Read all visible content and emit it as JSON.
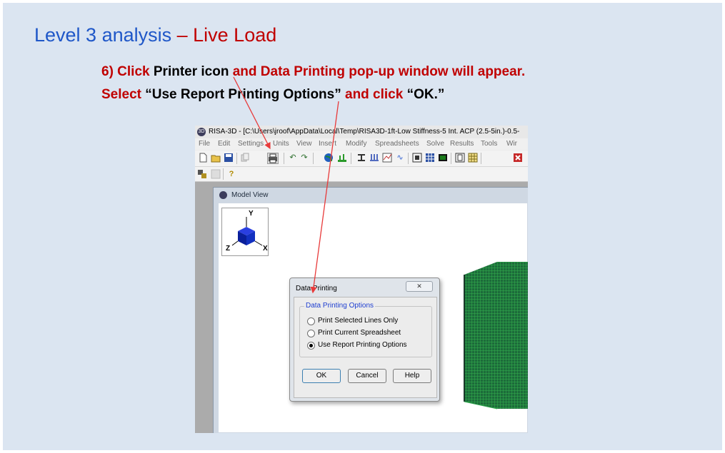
{
  "slide": {
    "title_part1": "Level 3 analysis",
    "title_part2": " – Live Load",
    "line1": {
      "a": "6) Click ",
      "b": "Printer icon",
      "c": " and Data Printing pop-up window will appear."
    },
    "line2": {
      "a": "Select ",
      "b": "“Use Report Printing Options”",
      "c": " and click ",
      "d": "“OK.”"
    },
    "bg_color": "#dbe5f1",
    "title_color": "#1f57c8",
    "accent_color": "#c00000",
    "arrow_color": "#e83a3a"
  },
  "app": {
    "window_title": "RISA-3D - [C:\\Users\\jroof\\AppData\\Local\\Temp\\RISA3D-1ft-Low Stiffness-5 Int. ACP (2.5-5in.)-0.5-",
    "app_icon_text": "3D",
    "menu": [
      "File",
      "Edit",
      "Settings",
      "Units",
      "View",
      "Insert",
      "Modify",
      "Spreadsheets",
      "Solve",
      "Results",
      "Tools",
      "Wir"
    ],
    "toolbar_icons": [
      "new-file-icon",
      "open-folder-icon",
      "save-icon",
      "copy-icon",
      "printer-icon",
      "undo-icon",
      "redo-icon",
      "globe-icon",
      "graph-icon",
      "member-icon",
      "load-icon",
      "chart-icon",
      "wave-icon",
      "view-box-icon",
      "grid-icon",
      "dark-view-icon",
      "frame-icon",
      "table-icon",
      "close-icon"
    ],
    "toolbar2_icons": [
      "node-icon",
      "disabled-icon",
      "help-icon"
    ],
    "help_glyph": "?",
    "model_view_title": "Model View",
    "axes": {
      "y": "Y",
      "z": "Z",
      "x": "X"
    }
  },
  "dialog": {
    "title": "Data Printing",
    "close_label": "✕",
    "group_label": "Data Printing Options",
    "options": [
      {
        "label": "Print Selected Lines Only",
        "selected": false
      },
      {
        "label": "Print Current Spreadsheet",
        "selected": false
      },
      {
        "label": "Use Report Printing Options",
        "selected": true
      }
    ],
    "buttons": {
      "ok": "OK",
      "cancel": "Cancel",
      "help": "Help"
    }
  }
}
